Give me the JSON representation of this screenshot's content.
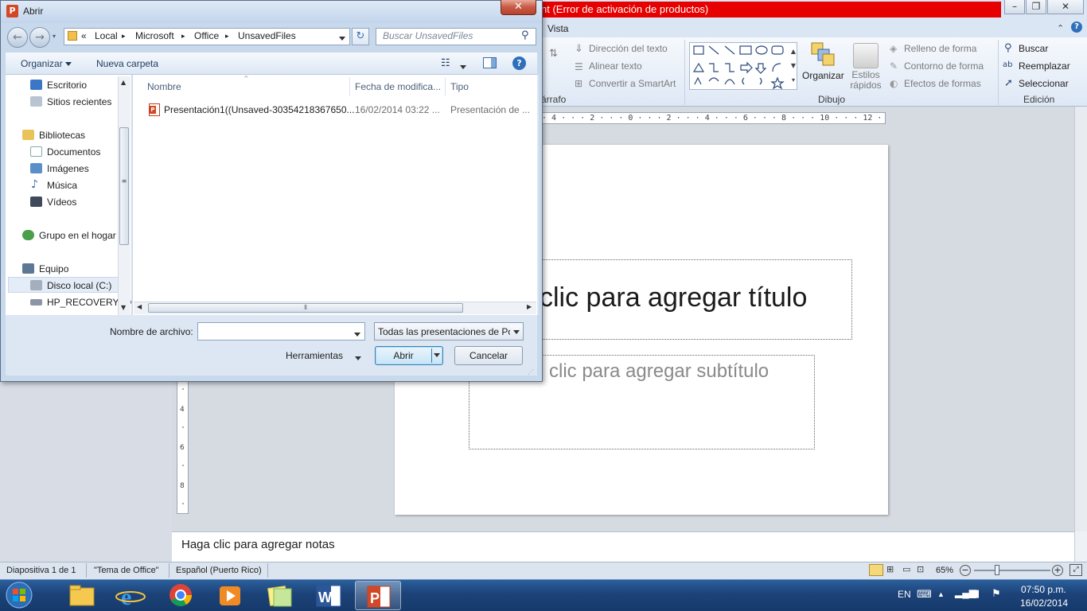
{
  "powerpoint": {
    "title_fragment": "nt (Error de activación de productos)",
    "tabs": {
      "vista": "Vista"
    },
    "ribbon": {
      "text_direction": "Dirección del texto",
      "align_text": "Alinear texto",
      "convert_smartart": "Convertir a SmartArt",
      "paragraph_group": "árrafo",
      "organize": "Organizar",
      "quick_styles": "Estilos rápidos",
      "shape_fill": "Relleno de forma",
      "shape_outline": "Contorno de forma",
      "shape_effects": "Efectos de formas",
      "drawing_group": "Dibujo",
      "find": "Buscar",
      "replace": "Reemplazar",
      "select": "Seleccionar",
      "editing_group": "Edición"
    },
    "ruler_text": "· 4 · · · 2 · · · 0 · · · 2 · · · 4 · · · 6 · · · 8 · · · 10 · · · 12 ·",
    "slide": {
      "title_placeholder": "clic para agregar título",
      "subtitle_placeholder": "clic para agregar subtítulo"
    },
    "notes_placeholder": "Haga clic para agregar notas",
    "status": {
      "slide": "Diapositiva 1 de 1",
      "theme": "\"Tema de Office\"",
      "language": "Español (Puerto Rico)",
      "zoom": "65%"
    }
  },
  "taskbar": {
    "apps": [
      "start",
      "file-explorer",
      "internet-explorer",
      "chrome",
      "media-player",
      "sticky-notes",
      "word",
      "powerpoint"
    ],
    "active_app": "powerpoint",
    "lang": "EN",
    "time": "07:50 p.m.",
    "date": "16/02/2014"
  },
  "dialog": {
    "title": "Abrir",
    "breadcrumb": [
      "Local",
      "Microsoft",
      "Office",
      "UnsavedFiles"
    ],
    "search_placeholder": "Buscar UnsavedFiles",
    "toolbar": {
      "organize": "Organizar",
      "new_folder": "Nueva carpeta"
    },
    "nav": {
      "desktop": "Escritorio",
      "recent": "Sitios recientes",
      "libraries": "Bibliotecas",
      "documents": "Documentos",
      "pictures": "Imágenes",
      "music": "Música",
      "videos": "Vídeos",
      "homegroup": "Grupo en el hogar",
      "computer": "Equipo",
      "local_disk": "Disco local (C:)",
      "recovery": "HP_RECOVERY (D"
    },
    "columns": {
      "name": "Nombre",
      "date": "Fecha de modifica...",
      "type": "Tipo"
    },
    "files": [
      {
        "name": "Presentación1((Unsaved-30354218367650...",
        "date": "16/02/2014 03:22 ...",
        "type": "Presentación de ..."
      }
    ],
    "filename_label": "Nombre de archivo:",
    "filename_value": "",
    "filetype": "Todas las presentaciones de Po",
    "tools": "Herramientas",
    "open": "Abrir",
    "cancel": "Cancelar"
  }
}
